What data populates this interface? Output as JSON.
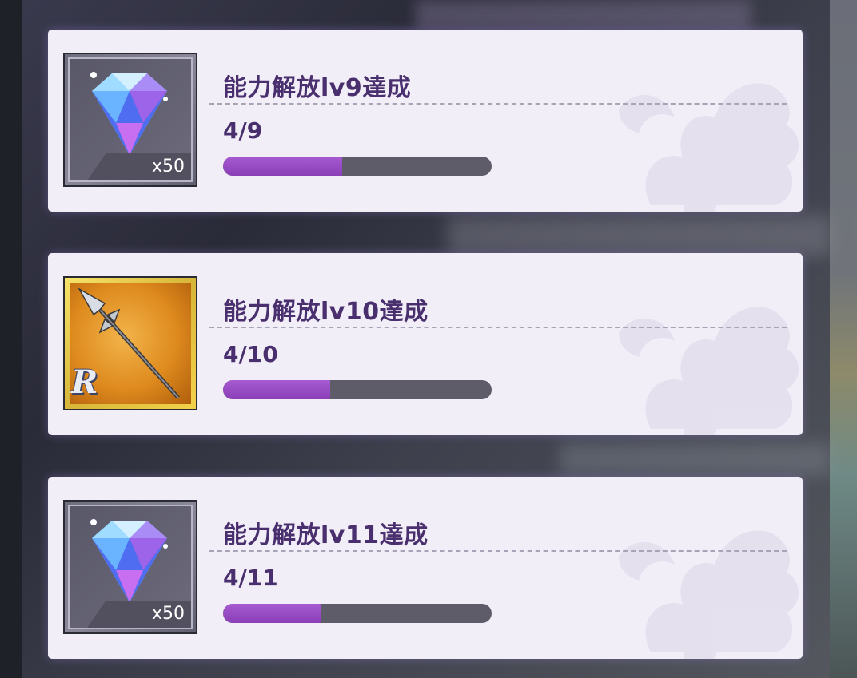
{
  "missions": [
    {
      "title": "能力解放lv9達成",
      "progress_text": "4/9",
      "progress_fraction": 0.444,
      "reward": {
        "icon": "diamond-gem-icon",
        "count_label": "x50",
        "frame": "silver"
      }
    },
    {
      "title": "能力解放lv10達成",
      "progress_text": "4/10",
      "progress_fraction": 0.4,
      "reward": {
        "icon": "spear-icon",
        "rarity_label": "R",
        "frame": "gold"
      }
    },
    {
      "title": "能力解放lv11達成",
      "progress_text": "4/11",
      "progress_fraction": 0.364,
      "reward": {
        "icon": "diamond-gem-icon",
        "count_label": "x50",
        "frame": "silver"
      }
    }
  ],
  "colors": {
    "card_bg": "#f1eef8",
    "title_text": "#4a2f6e",
    "progress_fill": "#9a4cc8",
    "progress_track": "#5e5c68"
  }
}
